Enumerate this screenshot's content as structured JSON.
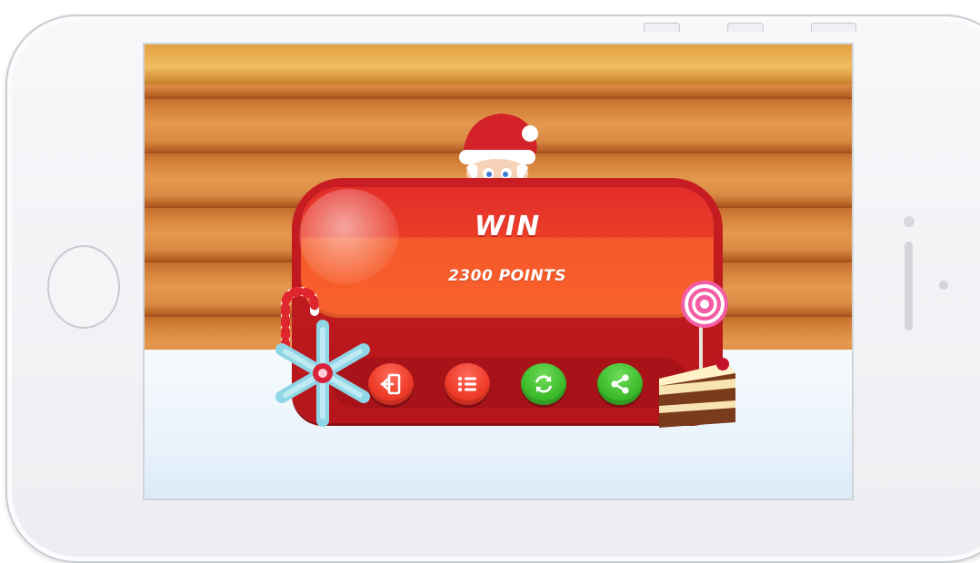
{
  "screen": {
    "title": "WIN",
    "points_text": "2300 POINTS"
  },
  "buttons": [
    {
      "name": "exit-button",
      "icon": "exit-icon",
      "color": "#ef3c2a"
    },
    {
      "name": "menu-list-button",
      "icon": "list-icon",
      "color": "#ef3c2a"
    },
    {
      "name": "restart-button",
      "icon": "refresh-icon",
      "color": "#3fbd2d"
    },
    {
      "name": "share-button",
      "icon": "share-icon",
      "color": "#3fbd2d"
    }
  ],
  "colors": {
    "panel_red": "#c81d22",
    "panel_orange": "#f8622c",
    "button_red": "#ef3c2a",
    "button_green": "#3fbd2d",
    "wall_wood": "#d7843d"
  },
  "decorations": [
    "santa",
    "candy-cane",
    "snowflake",
    "cake-with-lollipop"
  ]
}
